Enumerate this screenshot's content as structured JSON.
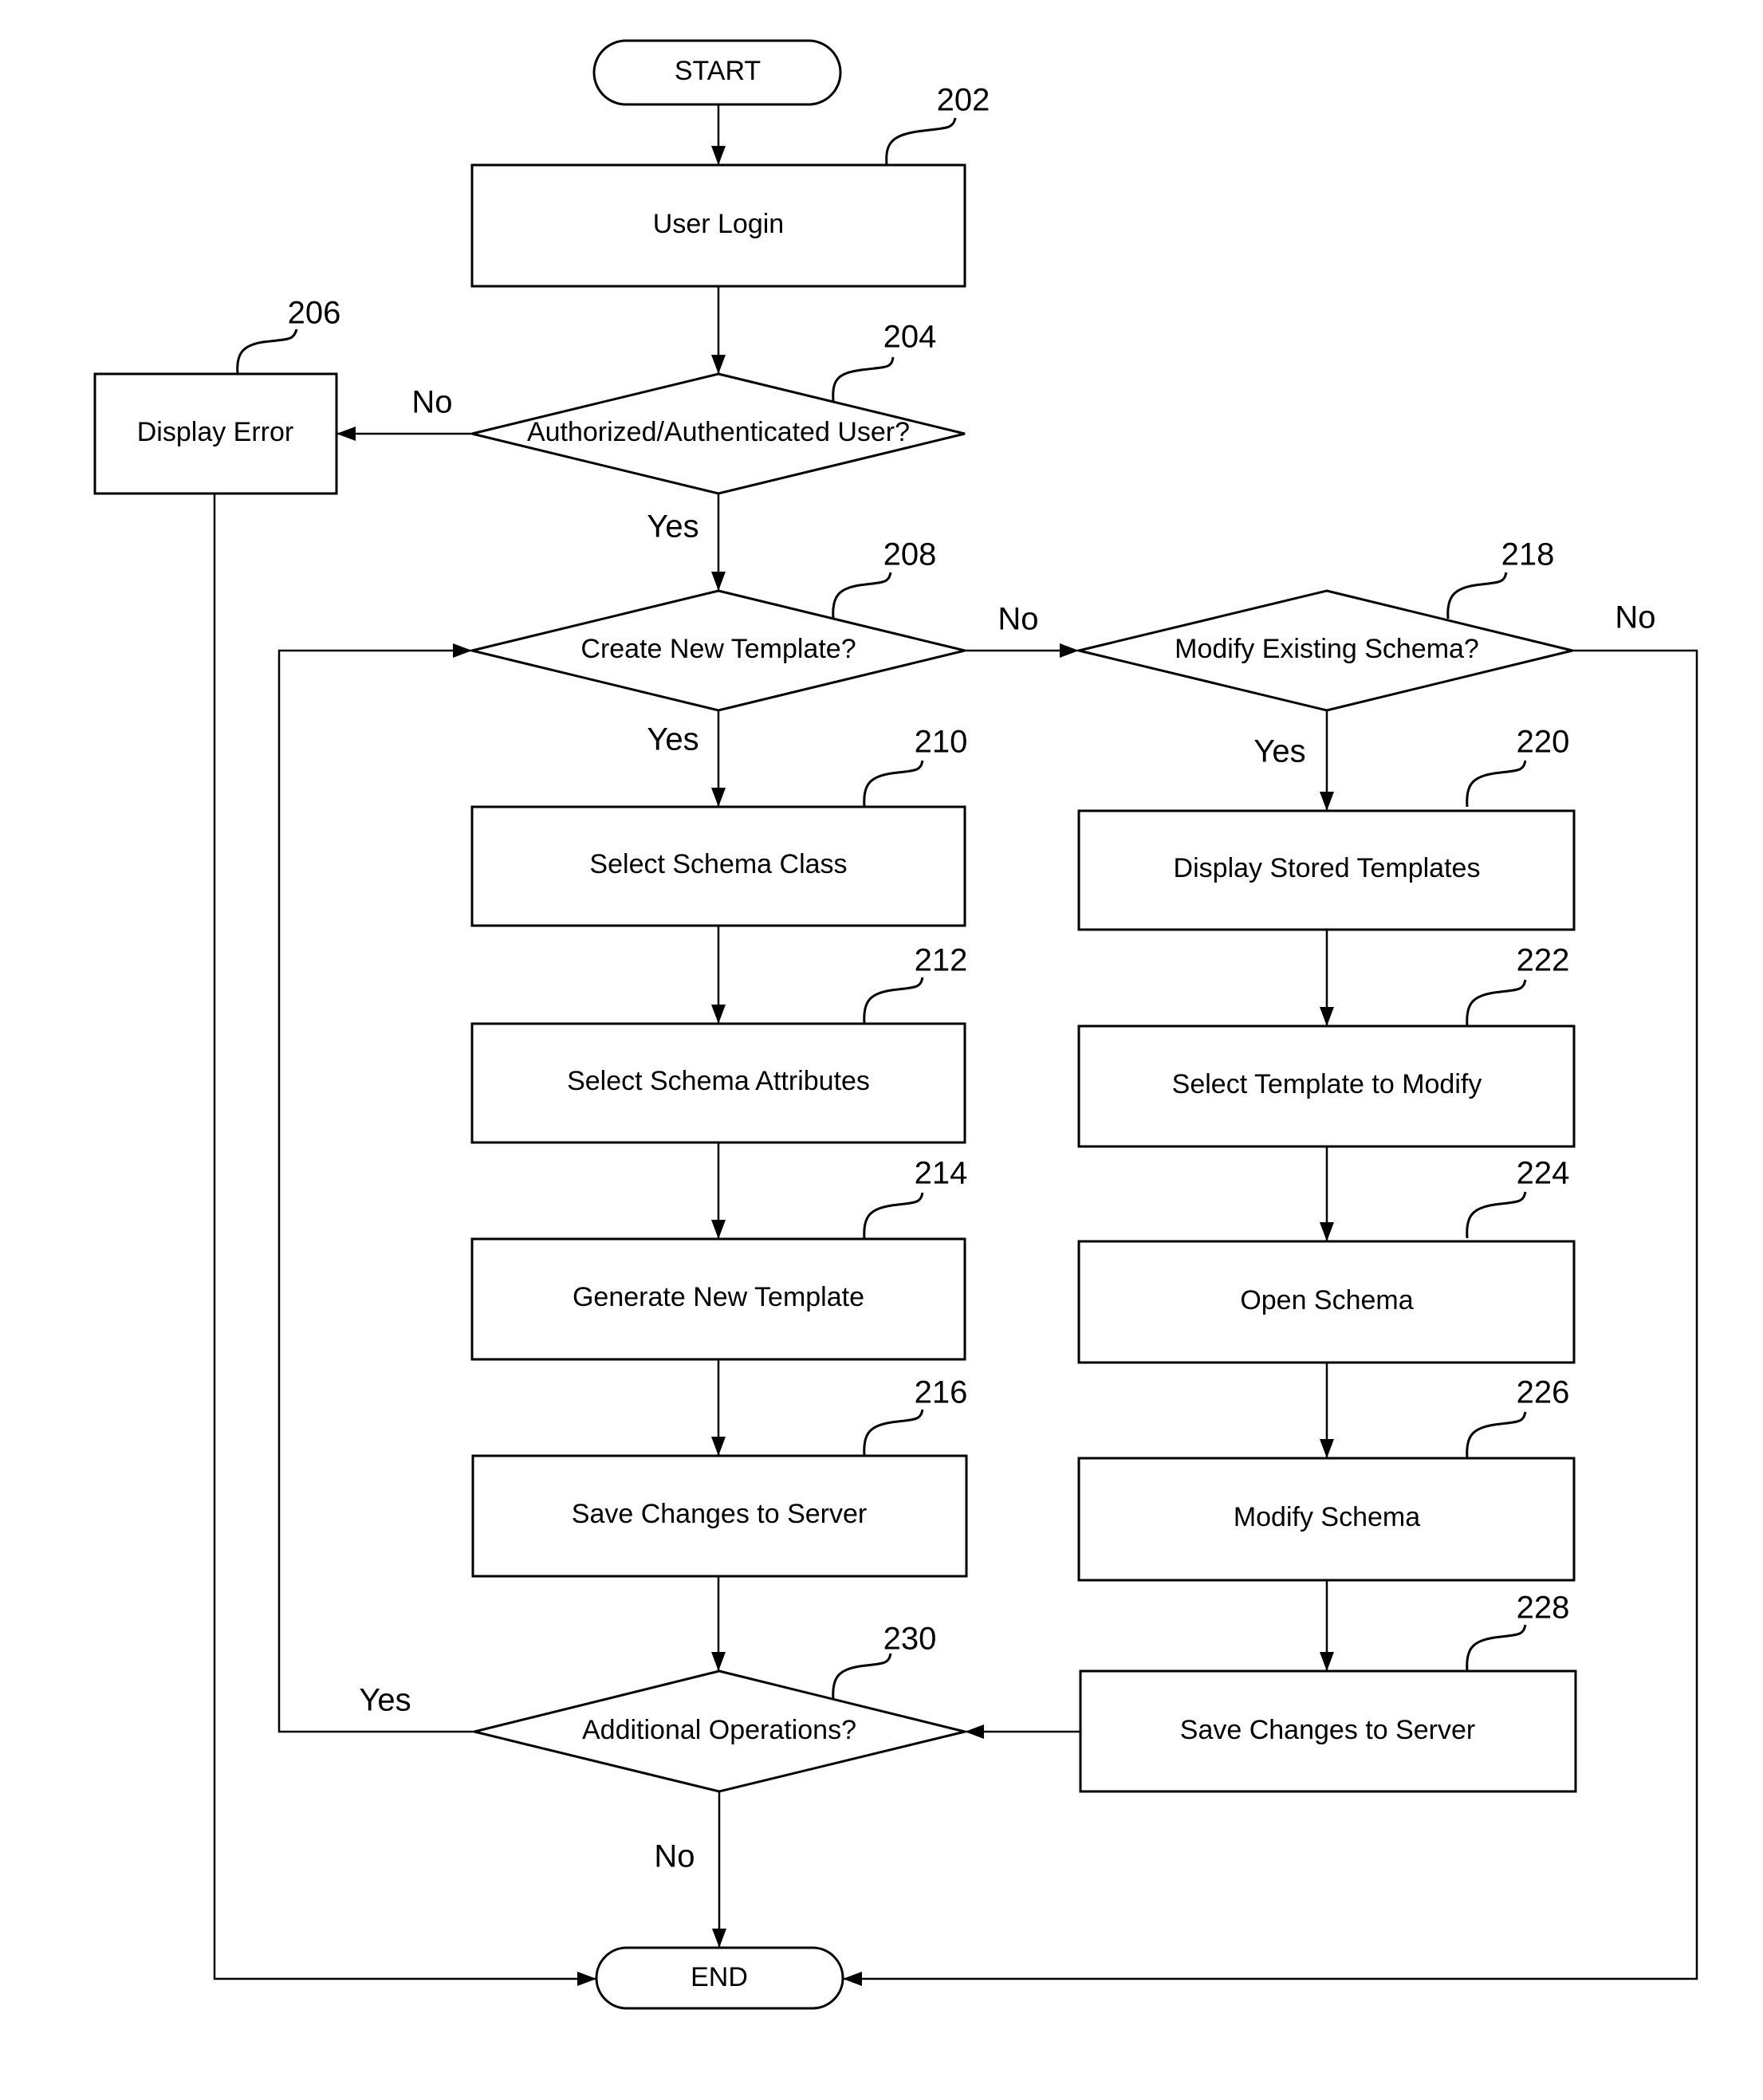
{
  "figure": {
    "nodes": {
      "start": {
        "label": "START"
      },
      "user_login": {
        "label": "User Login",
        "ref": "202"
      },
      "auth_check": {
        "label": "Authorized/Authenticated User?",
        "ref": "204"
      },
      "display_error": {
        "label": "Display Error",
        "ref": "206"
      },
      "create_template": {
        "label": "Create New Template?",
        "ref": "208"
      },
      "select_class": {
        "label": "Select Schema Class",
        "ref": "210"
      },
      "select_attributes": {
        "label": "Select Schema Attributes",
        "ref": "212"
      },
      "generate_template": {
        "label": "Generate New Template",
        "ref": "214"
      },
      "save_left": {
        "label": "Save Changes to Server",
        "ref": "216"
      },
      "modify_schema_q": {
        "label": "Modify Existing Schema?",
        "ref": "218"
      },
      "display_templates": {
        "label": "Display Stored Templates",
        "ref": "220"
      },
      "select_template": {
        "label": "Select Template to Modify",
        "ref": "222"
      },
      "open_schema": {
        "label": "Open Schema",
        "ref": "224"
      },
      "modify_schema": {
        "label": "Modify Schema",
        "ref": "226"
      },
      "save_right": {
        "label": "Save Changes to Server",
        "ref": "228"
      },
      "additional_ops": {
        "label": "Additional Operations?",
        "ref": "230"
      },
      "end": {
        "label": "END"
      }
    },
    "edge_labels": {
      "auth_no": "No",
      "auth_yes": "Yes",
      "create_no": "No",
      "create_yes": "Yes",
      "modify_no": "No",
      "modify_yes": "Yes",
      "additional_yes": "Yes",
      "additional_no": "No"
    }
  }
}
